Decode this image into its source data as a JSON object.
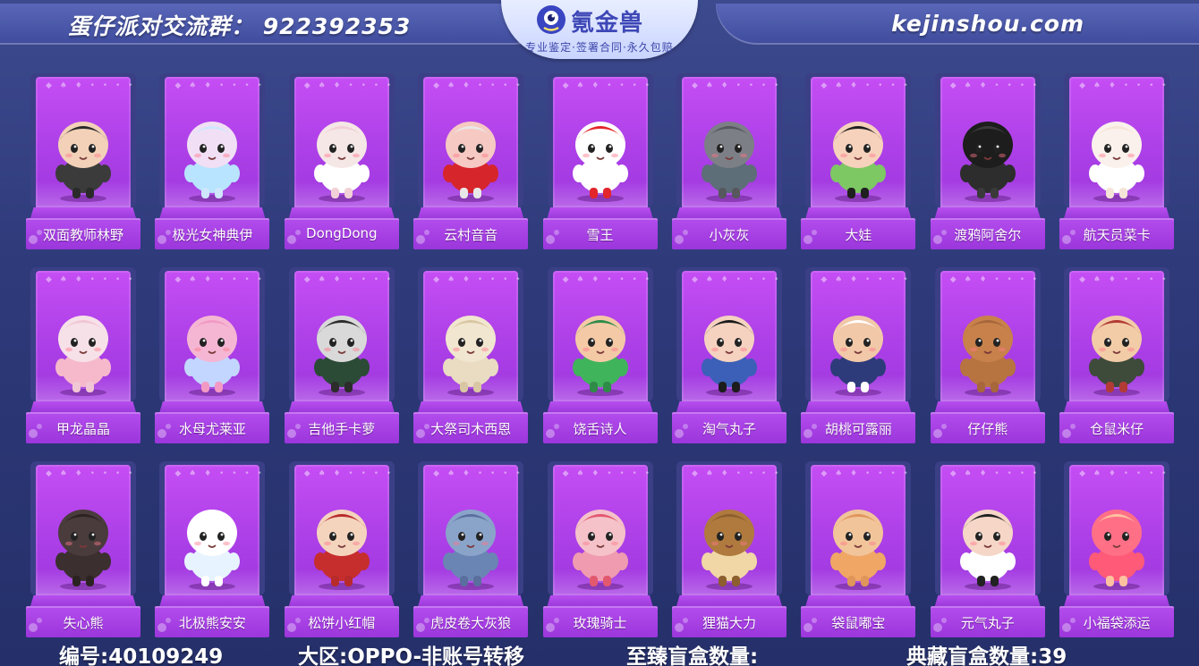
{
  "header": {
    "group": "蛋仔派对交流群：  922392353",
    "site": "kejinshou.com",
    "logo_name": "氪金兽",
    "logo_slogan": "专业鉴定·签署合同·永久包赔"
  },
  "cards": [
    {
      "name": "双面教师林野",
      "skin": "#f2d1b8",
      "body": "#3b3b3b",
      "hair": "#2a2a2a"
    },
    {
      "name": "极光女神典伊",
      "skin": "#f0dff5",
      "body": "#b9e4ff",
      "hair": "#cfe6ff"
    },
    {
      "name": "DongDong",
      "skin": "#f6e7e7",
      "body": "#ffffff",
      "hair": "#f1d0d8"
    },
    {
      "name": "云村音音",
      "skin": "#f6c9c2",
      "body": "#d6262c",
      "hair": "#e8e8e8"
    },
    {
      "name": "雪王",
      "skin": "#ffffff",
      "body": "#ffffff",
      "hair": "#e3262b"
    },
    {
      "name": "小灰灰",
      "skin": "#7c7f86",
      "body": "#5d6e78",
      "hair": "#56585e"
    },
    {
      "name": "大娃",
      "skin": "#f6d2bc",
      "body": "#7ec863",
      "hair": "#1f1f1f"
    },
    {
      "name": "渡鸦阿舍尔",
      "skin": "#1d1d1d",
      "body": "#2d2d2d",
      "hair": "#3a3a3a"
    },
    {
      "name": "航天员菜卡",
      "skin": "#fbf1ec",
      "body": "#ffffff",
      "hair": "#f5e5d8"
    },
    {
      "name": "甲龙晶晶",
      "skin": "#f7e1e8",
      "body": "#f6b9cc",
      "hair": "#f2c7d5"
    },
    {
      "name": "水母尤莱亚",
      "skin": "#f5b6d4",
      "body": "#c3d6ff",
      "hair": "#f29ac4"
    },
    {
      "name": "吉他手卡萝",
      "skin": "#d9d9d9",
      "body": "#2b4b37",
      "hair": "#2c2c2c"
    },
    {
      "name": "大祭司木西恩",
      "skin": "#f1e6cf",
      "body": "#e9dcc2",
      "hair": "#d9c7a3"
    },
    {
      "name": "饶舌诗人",
      "skin": "#f3c9a6",
      "body": "#3fb45a",
      "hair": "#2e8b48"
    },
    {
      "name": "淘气丸子",
      "skin": "#f5d2bf",
      "body": "#3c5fb8",
      "hair": "#1c1c1c"
    },
    {
      "name": "胡桃可露丽",
      "skin": "#f1c9a8",
      "body": "#2d3b7a",
      "hair": "#ffffff"
    },
    {
      "name": "仔仔熊",
      "skin": "#c8814a",
      "body": "#b87440",
      "hair": "#a8673a"
    },
    {
      "name": "仓鼠米仔",
      "skin": "#f2cba7",
      "body": "#3e4a3a",
      "hair": "#b33b35"
    },
    {
      "name": "失心熊",
      "skin": "#4a3c3c",
      "body": "#3b2f30",
      "hair": "#2b2222"
    },
    {
      "name": "北极熊安安",
      "skin": "#ffffff",
      "body": "#e7f3ff",
      "hair": "#ffffff"
    },
    {
      "name": "松饼小红帽",
      "skin": "#f5d4be",
      "body": "#c62d2d",
      "hair": "#b72b2b"
    },
    {
      "name": "虎皮卷大灰狼",
      "skin": "#8aa3c9",
      "body": "#6a84b3",
      "hair": "#5b6f9e"
    },
    {
      "name": "玫瑰骑士",
      "skin": "#f4c2c8",
      "body": "#f19bb0",
      "hair": "#e2586f"
    },
    {
      "name": "狸猫大力",
      "skin": "#b07a3e",
      "body": "#f0d7a5",
      "hair": "#8d5f2e"
    },
    {
      "name": "袋鼠嘟宝",
      "skin": "#f2c49a",
      "body": "#f0a765",
      "hair": "#e0965a"
    },
    {
      "name": "元气丸子",
      "skin": "#f6d6c6",
      "body": "#ffffff",
      "hair": "#222222"
    },
    {
      "name": "小福袋添运",
      "skin": "#ff6f86",
      "body": "#ff5a77",
      "hair": "#ffc2a0"
    }
  ],
  "footer": {
    "id": "编号:40109249",
    "region": "大区:OPPO-非账号转移",
    "zhizhen": "至臻盲盒数量:",
    "diancang": "典藏盲盒数量:39"
  }
}
